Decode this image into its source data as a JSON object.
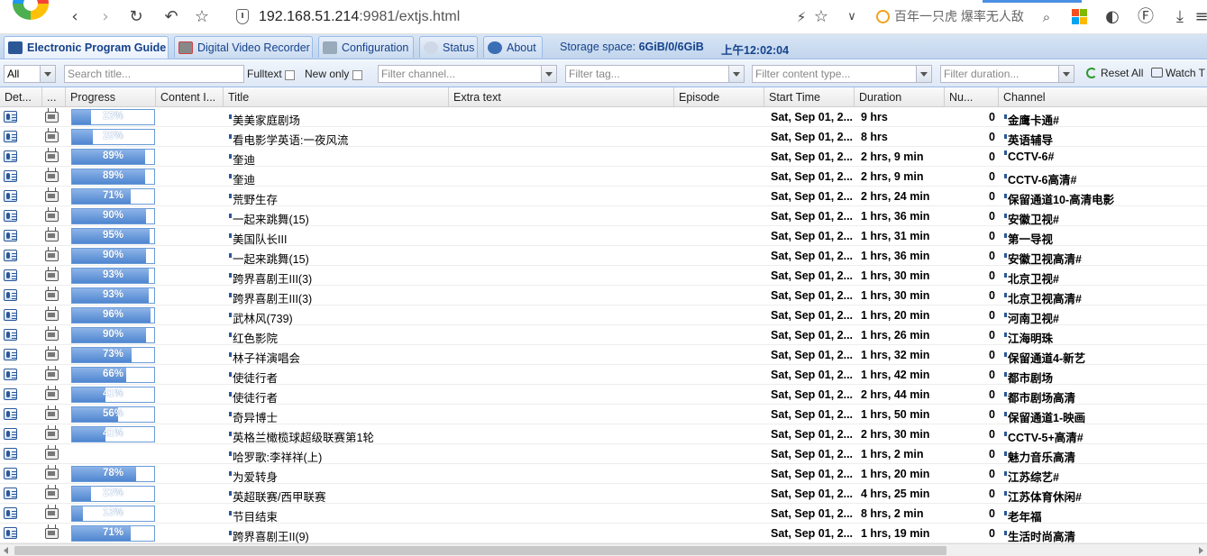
{
  "browser": {
    "url_host": "192.168.51.214",
    "url_rest": ":9981/extjs.html",
    "search_text": "百年一只虎  爆率无人敌"
  },
  "tabs": [
    {
      "label": "Electronic Program Guide",
      "icon": "epg-icon",
      "active": true
    },
    {
      "label": "Digital Video Recorder",
      "icon": "dvr-icon",
      "active": false
    },
    {
      "label": "Configuration",
      "icon": "wrench-icon",
      "active": false
    },
    {
      "label": "Status",
      "icon": "eye-icon",
      "active": false
    },
    {
      "label": "About",
      "icon": "info-icon",
      "active": false
    }
  ],
  "storage": {
    "label": "Storage space:",
    "value": "6GiB/0/6GiB"
  },
  "clock": "上午12:02:04",
  "toolbar": {
    "filter_all": "All",
    "search_placeholder": "Search title...",
    "fulltext_label": "Fulltext",
    "new_only_label": "New only",
    "channel_placeholder": "Filter channel...",
    "tag_placeholder": "Filter tag...",
    "content_type_placeholder": "Filter content type...",
    "duration_placeholder": "Filter duration...",
    "reset_label": "Reset All",
    "watch_label": "Watch T"
  },
  "columns": {
    "details": "Det...",
    "play": "...",
    "progress": "Progress",
    "content": "Content I...",
    "title": "Title",
    "extra": "Extra text",
    "episode": "Episode",
    "start": "Start Time",
    "duration": "Duration",
    "number": "Nu...",
    "channel": "Channel"
  },
  "rows": [
    {
      "progress": 23,
      "progress_text": "23%",
      "title": "美美家庭剧场",
      "start": "Sat, Sep 01, 2...",
      "duration": "9 hrs",
      "number": "0",
      "channel": "金鹰卡通#"
    },
    {
      "progress": 25,
      "progress_text": "25%",
      "title": "看电影学英语:一夜风流",
      "start": "Sat, Sep 01, 2...",
      "duration": "8 hrs",
      "number": "0",
      "channel": "英语辅导"
    },
    {
      "progress": 89,
      "progress_text": "89%",
      "title": "奎迪",
      "start": "Sat, Sep 01, 2...",
      "duration": "2 hrs, 9 min",
      "number": "0",
      "channel": "CCTV-6#"
    },
    {
      "progress": 89,
      "progress_text": "89%",
      "title": "奎迪",
      "start": "Sat, Sep 01, 2...",
      "duration": "2 hrs, 9 min",
      "number": "0",
      "channel": "CCTV-6高清#"
    },
    {
      "progress": 71,
      "progress_text": "71%",
      "title": "荒野生存",
      "start": "Sat, Sep 01, 2...",
      "duration": "2 hrs, 24 min",
      "number": "0",
      "channel": "保留通道10-高清电影"
    },
    {
      "progress": 90,
      "progress_text": "90%",
      "title": "一起来跳舞(15)",
      "start": "Sat, Sep 01, 2...",
      "duration": "1 hrs, 36 min",
      "number": "0",
      "channel": "安徽卫视#"
    },
    {
      "progress": 95,
      "progress_text": "95%",
      "title": "美国队长III",
      "start": "Sat, Sep 01, 2...",
      "duration": "1 hrs, 31 min",
      "number": "0",
      "channel": "第一导视"
    },
    {
      "progress": 90,
      "progress_text": "90%",
      "title": "一起来跳舞(15)",
      "start": "Sat, Sep 01, 2...",
      "duration": "1 hrs, 36 min",
      "number": "0",
      "channel": "安徽卫视高清#"
    },
    {
      "progress": 93,
      "progress_text": "93%",
      "title": "跨界喜剧王III(3)",
      "start": "Sat, Sep 01, 2...",
      "duration": "1 hrs, 30 min",
      "number": "0",
      "channel": "北京卫视#"
    },
    {
      "progress": 93,
      "progress_text": "93%",
      "title": "跨界喜剧王III(3)",
      "start": "Sat, Sep 01, 2...",
      "duration": "1 hrs, 30 min",
      "number": "0",
      "channel": "北京卫视高清#"
    },
    {
      "progress": 96,
      "progress_text": "96%",
      "title": "武林风(739)",
      "start": "Sat, Sep 01, 2...",
      "duration": "1 hrs, 20 min",
      "number": "0",
      "channel": "河南卫视#"
    },
    {
      "progress": 90,
      "progress_text": "90%",
      "title": "红色影院",
      "start": "Sat, Sep 01, 2...",
      "duration": "1 hrs, 26 min",
      "number": "0",
      "channel": "江海明珠"
    },
    {
      "progress": 73,
      "progress_text": "73%",
      "title": "林子祥演唱会",
      "start": "Sat, Sep 01, 2...",
      "duration": "1 hrs, 32 min",
      "number": "0",
      "channel": "保留通道4-新艺"
    },
    {
      "progress": 66,
      "progress_text": "66%",
      "title": "使徒行者",
      "start": "Sat, Sep 01, 2...",
      "duration": "1 hrs, 42 min",
      "number": "0",
      "channel": "都市剧场"
    },
    {
      "progress": 41,
      "progress_text": "41%",
      "title": "使徒行者",
      "start": "Sat, Sep 01, 2...",
      "duration": "2 hrs, 44 min",
      "number": "0",
      "channel": "都市剧场高清"
    },
    {
      "progress": 56,
      "progress_text": "56%",
      "title": "奇异博士",
      "start": "Sat, Sep 01, 2...",
      "duration": "1 hrs, 50 min",
      "number": "0",
      "channel": "保留通道1-映画"
    },
    {
      "progress": 41,
      "progress_text": "41%",
      "title": "英格兰橄榄球超级联赛第1轮",
      "start": "Sat, Sep 01, 2...",
      "duration": "2 hrs, 30 min",
      "number": "0",
      "channel": "CCTV-5+高清#"
    },
    {
      "progress": null,
      "progress_text": "",
      "title": "哈罗歌:李祥祥(上)",
      "start": "Sat, Sep 01, 2...",
      "duration": "1 hrs, 2 min",
      "number": "0",
      "channel": "魅力音乐高清"
    },
    {
      "progress": 78,
      "progress_text": "78%",
      "title": "为爱转身",
      "start": "Sat, Sep 01, 2...",
      "duration": "1 hrs, 20 min",
      "number": "0",
      "channel": "江苏综艺#"
    },
    {
      "progress": 23,
      "progress_text": "23%",
      "title": "英超联赛/西甲联赛",
      "start": "Sat, Sep 01, 2...",
      "duration": "4 hrs, 25 min",
      "number": "0",
      "channel": "江苏体育休闲#"
    },
    {
      "progress": 13,
      "progress_text": "13%",
      "title": "节目结束",
      "start": "Sat, Sep 01, 2...",
      "duration": "8 hrs, 2 min",
      "number": "0",
      "channel": "老年福"
    },
    {
      "progress": 71,
      "progress_text": "71%",
      "title": "跨界喜剧王II(9)",
      "start": "Sat, Sep 01, 2...",
      "duration": "1 hrs, 19 min",
      "number": "0",
      "channel": "生活时尚高清"
    }
  ]
}
